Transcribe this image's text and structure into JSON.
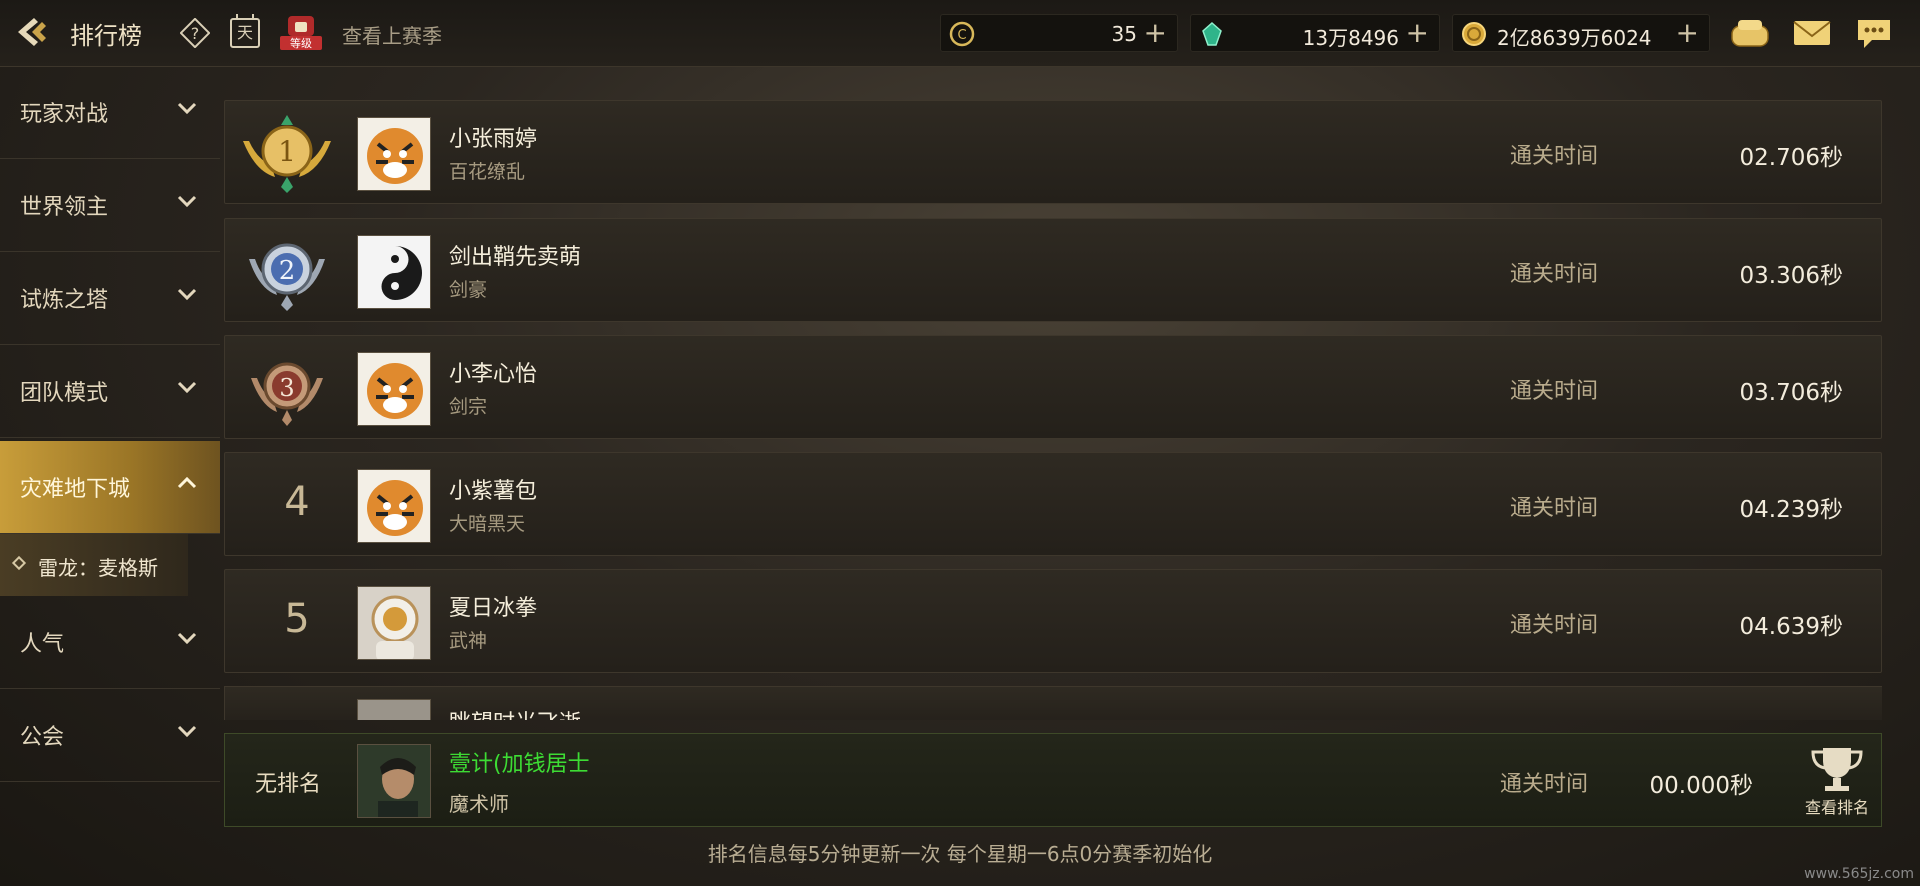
{
  "header": {
    "title": "排行榜",
    "calendar_text": "天",
    "level_text": "等级",
    "prev_season": "查看上赛季",
    "currencies": [
      {
        "icon": "c-coin-icon",
        "value": "35"
      },
      {
        "icon": "gem-icon",
        "value": "13万8496"
      },
      {
        "icon": "gold-coin-icon",
        "value": "2亿8639万6024"
      }
    ]
  },
  "sidebar": {
    "items": [
      {
        "label": "玩家对战",
        "expanded": false
      },
      {
        "label": "世界领主",
        "expanded": false
      },
      {
        "label": "试炼之塔",
        "expanded": false
      },
      {
        "label": "团队模式",
        "expanded": false
      },
      {
        "label": "灾难地下城",
        "expanded": true
      },
      {
        "label": "人气",
        "expanded": false
      },
      {
        "label": "公会",
        "expanded": false
      }
    ],
    "sub_item": "雷龙：麦格斯"
  },
  "rows": [
    {
      "rank": "1",
      "name": "小张雨婷",
      "class": "百花缭乱",
      "time_label": "通关时间",
      "time": "02.706秒"
    },
    {
      "rank": "2",
      "name": "剑出鞘先卖萌",
      "class": "剑豪",
      "time_label": "通关时间",
      "time": "03.306秒"
    },
    {
      "rank": "3",
      "name": "小李心怡",
      "class": "剑宗",
      "time_label": "通关时间",
      "time": "03.706秒"
    },
    {
      "rank": "4",
      "name": "小紫薯包",
      "class": "大暗黑天",
      "time_label": "通关时间",
      "time": "04.239秒"
    },
    {
      "rank": "5",
      "name": "夏日冰拳",
      "class": "武神",
      "time_label": "通关时间",
      "time": "04.639秒"
    }
  ],
  "partial_row": {
    "name": "眺望时光飞逝"
  },
  "self": {
    "rank": "无排名",
    "name": "壹计(加钱居士",
    "class": "魔术师",
    "time_label": "通关时间",
    "time": "00.000秒",
    "view_rank": "查看排名"
  },
  "footer": "排名信息每5分钟更新一次 每个星期一6点0分赛季初始化",
  "watermark": "www.565jz.com",
  "colors": {
    "accent_gold": "#c89d3a",
    "self_name_green": "#3ddc34"
  }
}
